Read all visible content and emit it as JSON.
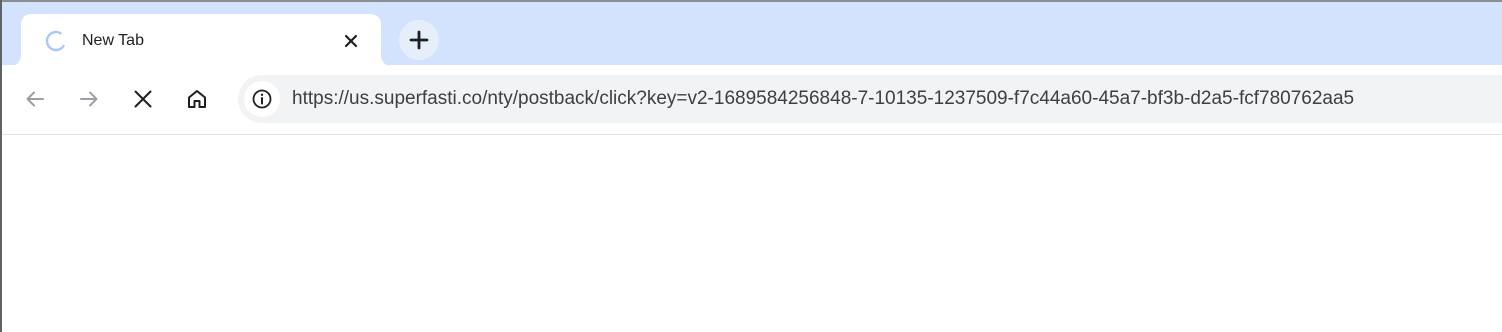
{
  "tab": {
    "title": "New Tab",
    "icon": "loading-spinner-icon",
    "close_icon": "close-icon"
  },
  "new_tab": {
    "icon": "plus-icon"
  },
  "toolbar": {
    "back_icon": "arrow-left-icon",
    "forward_icon": "arrow-right-icon",
    "stop_icon": "close-icon",
    "home_icon": "home-icon"
  },
  "omnibox": {
    "site_info_icon": "info-icon",
    "url": "https://us.superfasti.co/nty/postback/click?key=v2-1689584256848-7-10135-1237509-f7c44a60-45a7-bf3b-d2a5-fcf780762aa5"
  },
  "colors": {
    "tabstrip": "#d3e3fd",
    "active_tab": "#ffffff",
    "omnibox_bg": "#f1f3f4",
    "icon_dark": "#1f1f1f",
    "icon_disabled": "#9aa0a6"
  }
}
